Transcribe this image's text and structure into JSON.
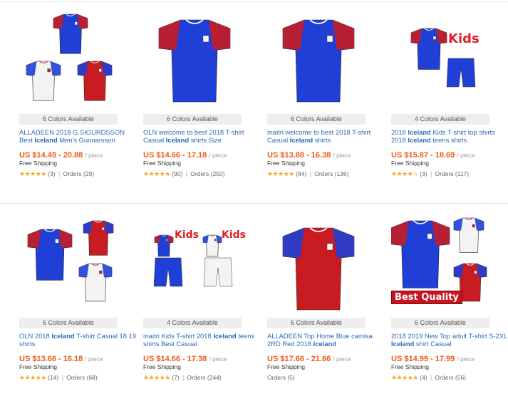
{
  "products": [
    {
      "colors": "6 Colors Available",
      "title_html": "ALLADEEN 2018 G.SIGURDSSON Best <b>Iceland</b> Men's Gunnarsson",
      "price": "US $14.49 - 20.88",
      "unit": "/ piece",
      "shipping": "Free Shipping",
      "stars": "★★★★★",
      "reviews": "(3)",
      "orders": "Orders (29)"
    },
    {
      "colors": "6 Colors Available",
      "title_html": "OLN welcome to best 2018 T-shirt Casual <b>Iceland</b> shirts Size",
      "price": "US $14.66 - 17.18",
      "unit": "/ piece",
      "shipping": "Free Shipping",
      "stars": "★★★★★",
      "reviews": "(90)",
      "orders": "Orders (250)"
    },
    {
      "colors": "6 Colors Available",
      "title_html": "maitri welcome to best 2018 T-shirt Casual <b>Iceland</b> shirts",
      "price": "US $13.88 - 16.38",
      "unit": "/ piece",
      "shipping": "Free Shipping",
      "stars": "★★★★★",
      "reviews": "(84)",
      "orders": "Orders (136)"
    },
    {
      "colors": "4 Colors Available",
      "title_html": "2018 <b>Iceland</b> Kids T-shirt top shirts 2018 <b>Iceland</b> teens shirts",
      "price": "US $15.87 - 18.69",
      "unit": "/ piece",
      "shipping": "Free Shipping",
      "stars": "★★★★☆",
      "reviews": "(3)",
      "orders": "Orders (117)",
      "badge": "Kids"
    },
    {
      "colors": "6 Colors Available",
      "title_html": "OLN 2018 <b>Iceland</b> T-shirt Casual 18 19 shirts",
      "price": "US $13.66 - 16.18",
      "unit": "/ piece",
      "shipping": "Free Shipping",
      "stars": "★★★★★",
      "reviews": "(14)",
      "orders": "Orders (68)"
    },
    {
      "colors": "4 Colors Available",
      "title_html": "maitri Kids T-shirt 2018 <b>Iceland</b> teens shirts Best Casual",
      "price": "US $14.66 - 17.38",
      "unit": "/ piece",
      "shipping": "Free Shipping",
      "stars": "★★★★★",
      "reviews": "(7)",
      "orders": "Orders (244)",
      "badge": "Kids"
    },
    {
      "colors": "6 Colors Available",
      "title_html": "ALLADEEN Top Home Blue camisa 2RD Red 2018 <b>Iceland</b>",
      "price": "US $17.66 - 21.66",
      "unit": "/ piece",
      "shipping": "Free Shipping",
      "stars": "",
      "reviews": "",
      "orders": "Orders (5)"
    },
    {
      "colors": "6 Colors Available",
      "title_html": "2018 2019 New Top adult T-shirt S-2XL <b>Iceland</b> shirt Casual",
      "price": "US $14.99 - 17.99",
      "unit": "/ piece",
      "shipping": "Free Shipping",
      "stars": "★★★★★",
      "reviews": "(4)",
      "orders": "Orders (56)",
      "badge": "Best Quality"
    }
  ],
  "colors": {
    "blue": "#1f3fd6",
    "red": "#c81c22",
    "white": "#f3f3f3",
    "price": "#f05a1a",
    "link": "#2a6bb8",
    "star": "#f6a623"
  }
}
